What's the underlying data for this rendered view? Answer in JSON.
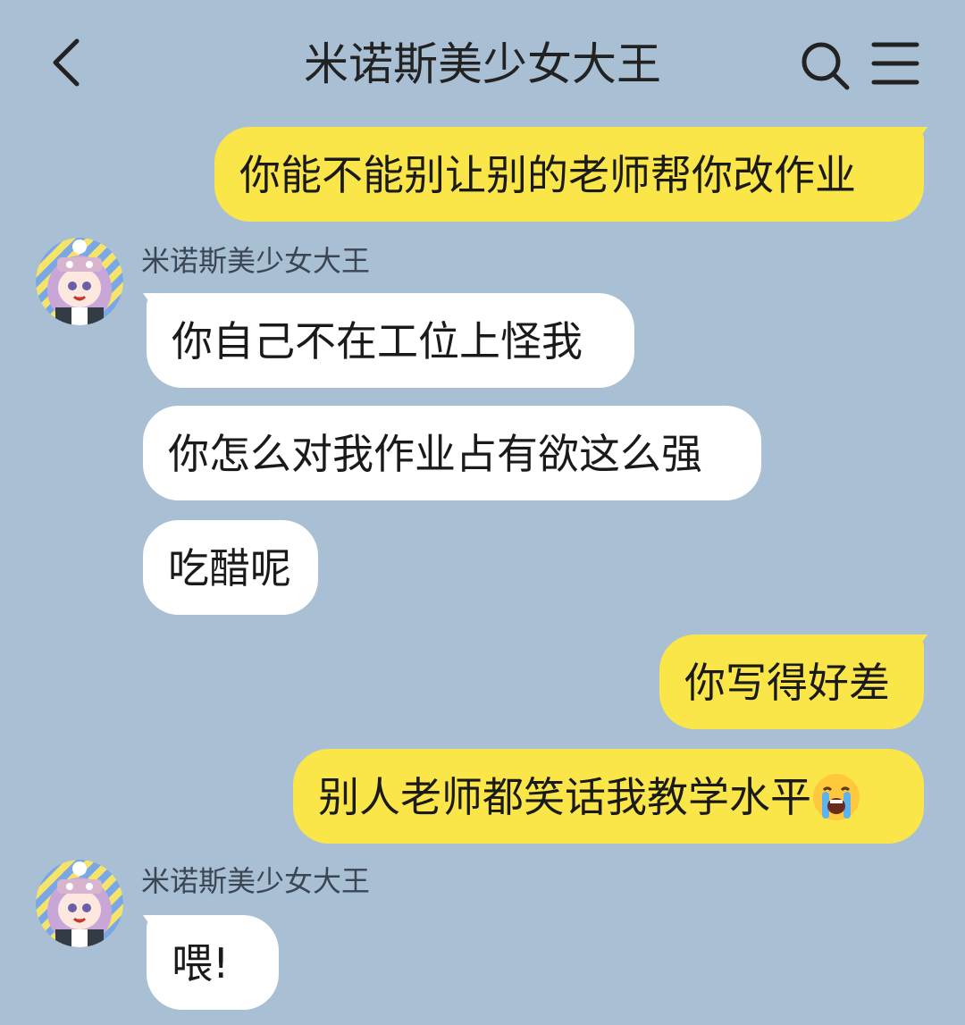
{
  "header": {
    "title": "米诺斯美少女大王"
  },
  "messages": [
    {
      "side": "out",
      "text": "你能不能别让别的老师帮你改作业"
    },
    {
      "side": "in",
      "sender": "米诺斯美少女大王",
      "text": "你自己不在工位上怪我"
    },
    {
      "side": "in",
      "text": "你怎么对我作业占有欲这么强"
    },
    {
      "side": "in",
      "text": "吃醋呢"
    },
    {
      "side": "out",
      "text": "你写得好差"
    },
    {
      "side": "out",
      "text": "别人老师都笑话我教学水平",
      "emoji": "loudly-crying-face"
    },
    {
      "side": "in",
      "sender": "米诺斯美少女大王",
      "text": "喂!"
    }
  ],
  "colors": {
    "background": "#a9bfd4",
    "outgoing_bubble": "#fbe64a",
    "incoming_bubble": "#ffffff"
  }
}
